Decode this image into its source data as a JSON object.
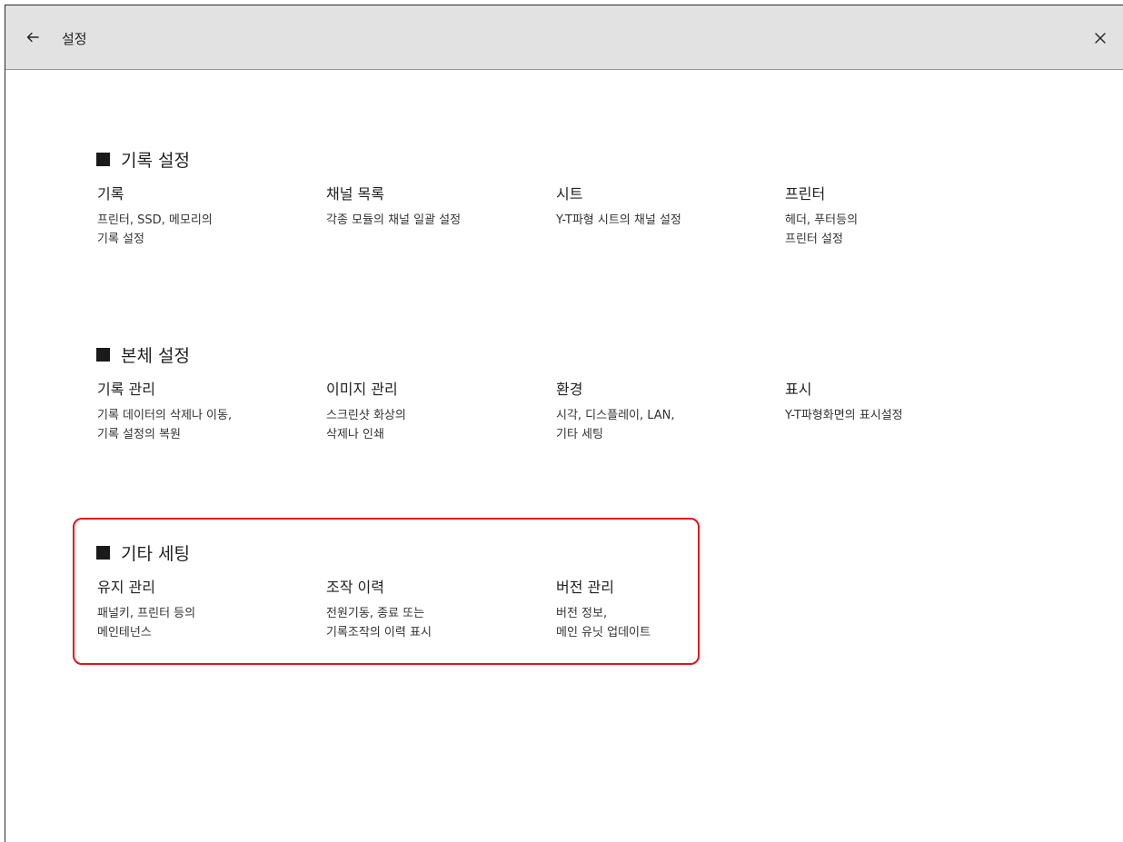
{
  "header": {
    "title": "설정",
    "back_icon": "arrow-left-icon",
    "close_icon": "close-icon"
  },
  "sections": [
    {
      "title": "기록 설정",
      "items": [
        {
          "title": "기록",
          "desc": "프린터, SSD, 메모리의\n기록 설정"
        },
        {
          "title": "채널 목록",
          "desc": "각종 모듈의 채널 일괄 설정"
        },
        {
          "title": "시트",
          "desc": "Y-T파형 시트의 채널 설정"
        },
        {
          "title": "프린터",
          "desc": "헤더, 푸터등의\n프린터 설정"
        }
      ]
    },
    {
      "title": "본체 설정",
      "items": [
        {
          "title": "기록 관리",
          "desc": "기록 데이터의 삭제나 이동,\n기록 설정의 복원"
        },
        {
          "title": "이미지 관리",
          "desc": "스크린샷 화상의\n삭제나 인쇄"
        },
        {
          "title": "환경",
          "desc": "시각, 디스플레이, LAN,\n기타 세팅"
        },
        {
          "title": "표시",
          "desc": "Y-T파형화면의 표시설정"
        }
      ]
    },
    {
      "title": "기타 세팅",
      "items": [
        {
          "title": "유지 관리",
          "desc": "패널키, 프린터 등의\n메인테넌스"
        },
        {
          "title": "조작 이력",
          "desc": "전원기동, 종료 또는\n기록조작의 이력 표시"
        },
        {
          "title": "버전 관리",
          "desc": "버전 정보,\n메인 유닛 업데이트"
        }
      ]
    }
  ],
  "colors": {
    "highlight": "#e2141b",
    "titlebar": "#e2e2e2"
  }
}
